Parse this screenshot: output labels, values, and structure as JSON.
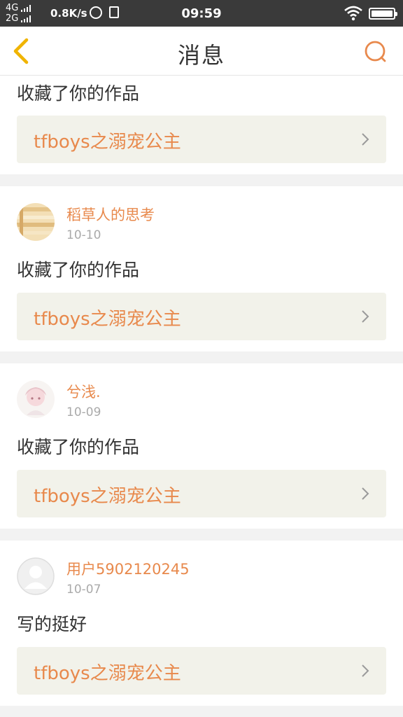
{
  "status_bar": {
    "net_line1": "4G",
    "net_line2": "2G",
    "speed": "0.8K/s",
    "time": "09:59"
  },
  "header": {
    "title": "消息",
    "back_icon": "chevron-left-icon",
    "search_icon": "search-icon"
  },
  "colors": {
    "accent": "#e8894c",
    "back_icon": "#f0b400",
    "link_bg": "#f2f2ea",
    "divider": "#f2f2f2"
  },
  "messages": [
    {
      "text": "收藏了你的作品",
      "work": "tfboys之溺宠公主"
    },
    {
      "user": "稻草人的思考",
      "date": "10-10",
      "text": "收藏了你的作品",
      "work": "tfboys之溺宠公主"
    },
    {
      "user": "兮浅.",
      "date": "10-09",
      "text": "收藏了你的作品",
      "work": "tfboys之溺宠公主"
    },
    {
      "user": "用户5902120245",
      "date": "10-07",
      "text": "写的挺好",
      "work": "tfboys之溺宠公主"
    }
  ]
}
